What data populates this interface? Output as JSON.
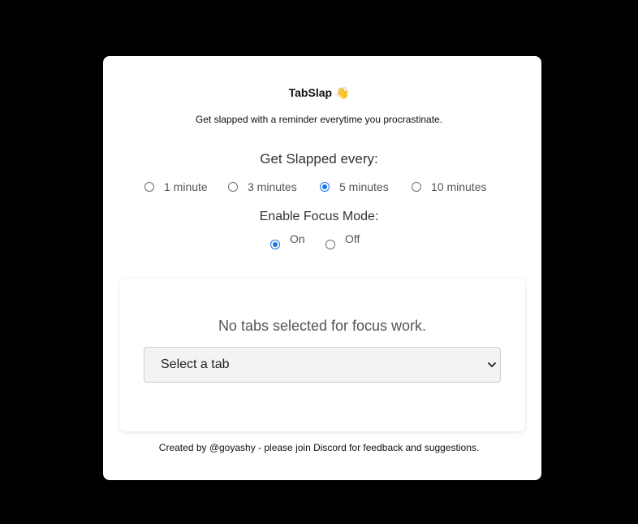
{
  "app": {
    "title": "TabSlap",
    "title_emoji": "👋",
    "subtitle": "Get slapped with a reminder everytime you procrastinate."
  },
  "interval": {
    "label": "Get Slapped every:",
    "options": [
      {
        "label": "1 minute",
        "checked": false
      },
      {
        "label": "3 minutes",
        "checked": false
      },
      {
        "label": "5 minutes",
        "checked": true
      },
      {
        "label": "10 minutes",
        "checked": false
      }
    ]
  },
  "focus_mode": {
    "label": "Enable Focus Mode:",
    "options": [
      {
        "label": "On",
        "checked": true
      },
      {
        "label": "Off",
        "checked": false
      }
    ]
  },
  "focus_tabs": {
    "empty_message": "No tabs selected for focus work.",
    "select_value": "Select a tab"
  },
  "footer": {
    "text": "Created by @goyashy - please join Discord for feedback and suggestions."
  },
  "colors": {
    "accent": "#1a73e8",
    "background": "#000000",
    "card": "#ffffff"
  }
}
